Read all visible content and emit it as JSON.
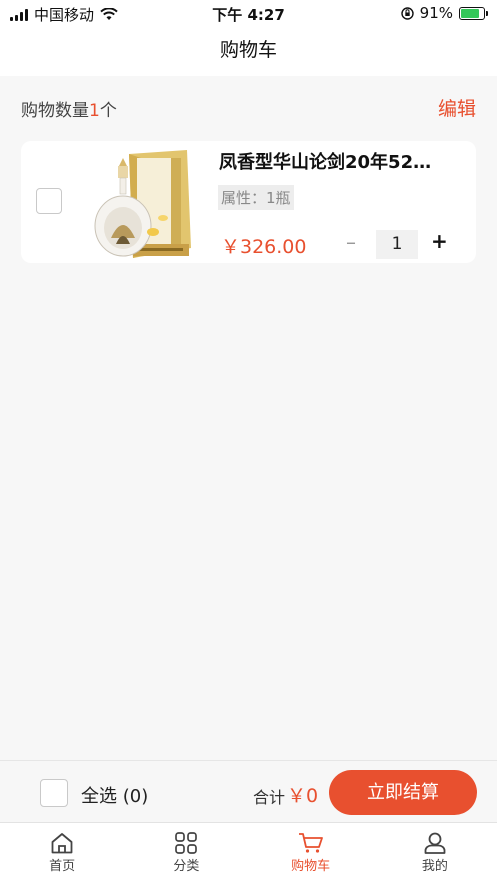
{
  "status_bar": {
    "carrier": "中国移动",
    "time": "下午 4:27",
    "battery_percent": "91%",
    "battery_level": 0.91
  },
  "nav": {
    "title": "购物车"
  },
  "cart_header": {
    "count_label": "购物数量",
    "count": "1",
    "count_unit": "个",
    "edit_label": "编辑"
  },
  "items": [
    {
      "title": "凤香型华山论剑20年52…",
      "attr": "属性：1瓶",
      "price": "￥326.00",
      "minus": "–",
      "quantity": "1",
      "plus": "+",
      "checked": false
    }
  ],
  "checkout": {
    "select_all_label": "全选 (0)",
    "total_label": "合计",
    "total_value": "￥0",
    "button_label": "立即结算"
  },
  "tabbar": {
    "tabs": [
      {
        "label": "首页",
        "icon": "home-icon"
      },
      {
        "label": "分类",
        "icon": "category-icon"
      },
      {
        "label": "购物车",
        "icon": "cart-icon",
        "active": true
      },
      {
        "label": "我的",
        "icon": "user-icon"
      }
    ]
  },
  "colors": {
    "accent": "#e8502f",
    "background": "#f7f7f7",
    "battery": "#34c759"
  }
}
